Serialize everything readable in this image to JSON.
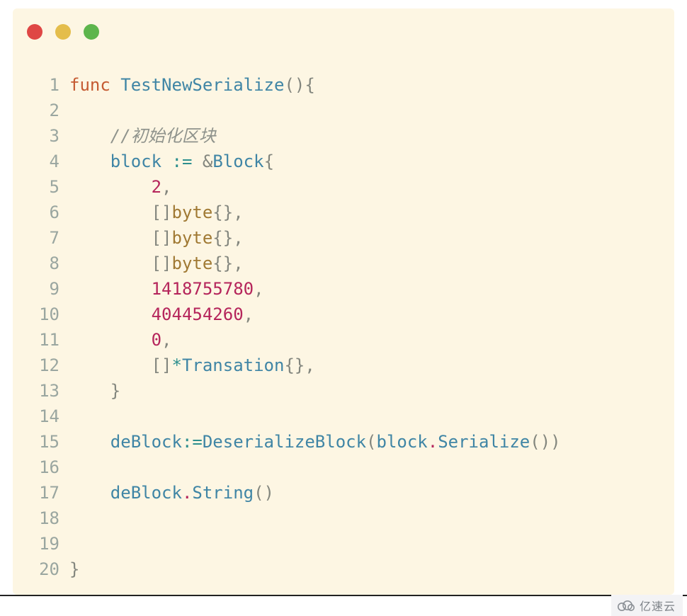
{
  "watermark": {
    "text": "亿速云"
  },
  "code": {
    "lines": [
      {
        "n": 1,
        "tokens": [
          {
            "cls": "tok-key",
            "t": "func"
          },
          {
            "cls": "tok-plain",
            "t": " "
          },
          {
            "cls": "tok-ident",
            "t": "TestNewSerialize"
          },
          {
            "cls": "tok-plain",
            "t": "(){"
          }
        ]
      },
      {
        "n": 2,
        "tokens": []
      },
      {
        "n": 3,
        "tokens": [
          {
            "cls": "tok-plain",
            "t": "    "
          },
          {
            "cls": "tok-comment",
            "t": "//初始化区块"
          }
        ]
      },
      {
        "n": 4,
        "tokens": [
          {
            "cls": "tok-plain",
            "t": "    "
          },
          {
            "cls": "tok-ident",
            "t": "block"
          },
          {
            "cls": "tok-plain",
            "t": " "
          },
          {
            "cls": "tok-op",
            "t": ":="
          },
          {
            "cls": "tok-plain",
            "t": " "
          },
          {
            "cls": "tok-plain",
            "t": "&"
          },
          {
            "cls": "tok-ident",
            "t": "Block"
          },
          {
            "cls": "tok-plain",
            "t": "{"
          }
        ]
      },
      {
        "n": 5,
        "tokens": [
          {
            "cls": "tok-plain",
            "t": "        "
          },
          {
            "cls": "tok-num",
            "t": "2"
          },
          {
            "cls": "tok-plain",
            "t": ","
          }
        ]
      },
      {
        "n": 6,
        "tokens": [
          {
            "cls": "tok-plain",
            "t": "        []"
          },
          {
            "cls": "tok-builtin",
            "t": "byte"
          },
          {
            "cls": "tok-plain",
            "t": "{},"
          }
        ]
      },
      {
        "n": 7,
        "tokens": [
          {
            "cls": "tok-plain",
            "t": "        []"
          },
          {
            "cls": "tok-builtin",
            "t": "byte"
          },
          {
            "cls": "tok-plain",
            "t": "{},"
          }
        ]
      },
      {
        "n": 8,
        "tokens": [
          {
            "cls": "tok-plain",
            "t": "        []"
          },
          {
            "cls": "tok-builtin",
            "t": "byte"
          },
          {
            "cls": "tok-plain",
            "t": "{},"
          }
        ]
      },
      {
        "n": 9,
        "tokens": [
          {
            "cls": "tok-plain",
            "t": "        "
          },
          {
            "cls": "tok-num",
            "t": "1418755780"
          },
          {
            "cls": "tok-plain",
            "t": ","
          }
        ]
      },
      {
        "n": 10,
        "tokens": [
          {
            "cls": "tok-plain",
            "t": "        "
          },
          {
            "cls": "tok-num",
            "t": "404454260"
          },
          {
            "cls": "tok-plain",
            "t": ","
          }
        ]
      },
      {
        "n": 11,
        "tokens": [
          {
            "cls": "tok-plain",
            "t": "        "
          },
          {
            "cls": "tok-num",
            "t": "0"
          },
          {
            "cls": "tok-plain",
            "t": ","
          }
        ]
      },
      {
        "n": 12,
        "tokens": [
          {
            "cls": "tok-plain",
            "t": "        []"
          },
          {
            "cls": "tok-star",
            "t": "*"
          },
          {
            "cls": "tok-ident",
            "t": "Transation"
          },
          {
            "cls": "tok-plain",
            "t": "{},"
          }
        ]
      },
      {
        "n": 13,
        "tokens": [
          {
            "cls": "tok-plain",
            "t": "    }"
          }
        ]
      },
      {
        "n": 14,
        "tokens": []
      },
      {
        "n": 15,
        "tokens": [
          {
            "cls": "tok-plain",
            "t": "    "
          },
          {
            "cls": "tok-ident",
            "t": "deBlock"
          },
          {
            "cls": "tok-op",
            "t": ":="
          },
          {
            "cls": "tok-ident",
            "t": "DeserializeBlock"
          },
          {
            "cls": "tok-plain",
            "t": "("
          },
          {
            "cls": "tok-ident",
            "t": "block"
          },
          {
            "cls": "tok-dot",
            "t": "."
          },
          {
            "cls": "tok-ident",
            "t": "Serialize"
          },
          {
            "cls": "tok-plain",
            "t": "())"
          }
        ]
      },
      {
        "n": 16,
        "tokens": []
      },
      {
        "n": 17,
        "tokens": [
          {
            "cls": "tok-plain",
            "t": "    "
          },
          {
            "cls": "tok-ident",
            "t": "deBlock"
          },
          {
            "cls": "tok-dot",
            "t": "."
          },
          {
            "cls": "tok-ident",
            "t": "String"
          },
          {
            "cls": "tok-plain",
            "t": "()"
          }
        ]
      },
      {
        "n": 18,
        "tokens": []
      },
      {
        "n": 19,
        "tokens": []
      },
      {
        "n": 20,
        "tokens": [
          {
            "cls": "tok-plain",
            "t": "}"
          }
        ]
      }
    ]
  }
}
